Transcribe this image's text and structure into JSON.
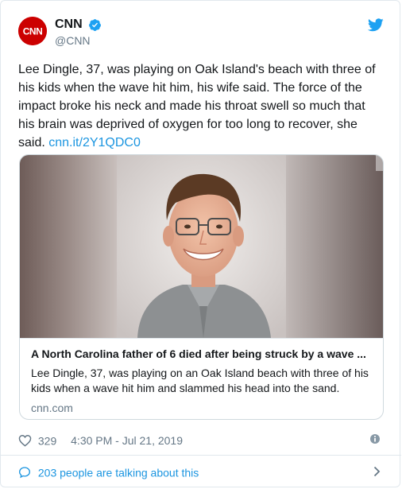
{
  "user": {
    "display_name": "CNN",
    "handle": "@CNN",
    "avatar_text": "CNN",
    "verified": true
  },
  "tweet": {
    "text": "Lee Dingle, 37, was playing on Oak Island's beach with three of his kids when the wave hit him, his wife said. The force of the impact broke his neck and made his throat swell so much that his brain was deprived of oxygen for too long to recover, she said.",
    "link": "cnn.it/2Y1QDC0"
  },
  "card": {
    "title": "A North Carolina father of 6 died after being struck by a wave ...",
    "description": "Lee Dingle, 37, was playing on an Oak Island beach with three of his kids when a wave hit him and slammed his head into the sand.",
    "domain": "cnn.com"
  },
  "meta": {
    "likes": "329",
    "timestamp": "4:30 PM - Jul 21, 2019"
  },
  "footer": {
    "label": "203 people are talking about this"
  },
  "icons": {
    "verified": "verified-badge-icon",
    "twitter": "twitter-bird-icon",
    "like": "heart-icon",
    "info": "info-icon",
    "reply": "speech-bubble-icon",
    "more": "chevron-right-icon"
  },
  "colors": {
    "brand_red": "#cc0000",
    "link_blue": "#1b95e0",
    "verified_blue": "#1da1f2",
    "secondary_text": "#657786",
    "border": "#e1e8ed"
  }
}
